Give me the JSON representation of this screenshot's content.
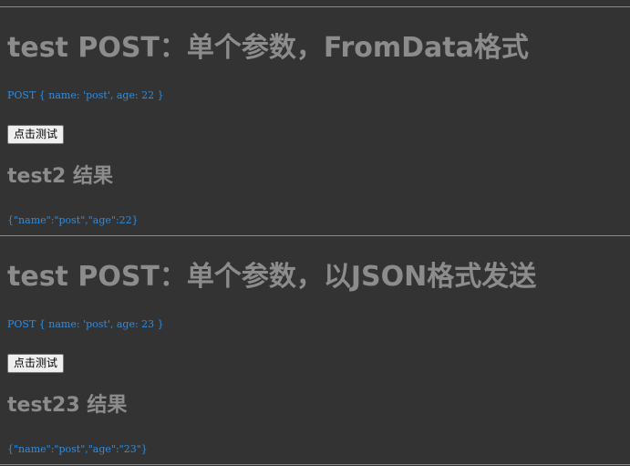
{
  "sections": [
    {
      "title": "test POST：单个参数，FromData格式",
      "request_text": "POST { name: 'post', age: 22 }",
      "button_label": "点击测试",
      "result_heading": "test2 结果",
      "result_text": "{\"name\":\"post\",\"age\":22}"
    },
    {
      "title": "test POST：单个参数，以JSON格式发送",
      "request_text": "POST { name: 'post', age: 23 }",
      "button_label": "点击测试",
      "result_heading": "test23 结果",
      "result_text": "{\"name\":\"post\",\"age\":\"23\"}"
    }
  ],
  "colors": {
    "background": "#333333",
    "heading": "#8c8c8c",
    "code": "#2f8de0",
    "rule": "#8a8a8a"
  }
}
